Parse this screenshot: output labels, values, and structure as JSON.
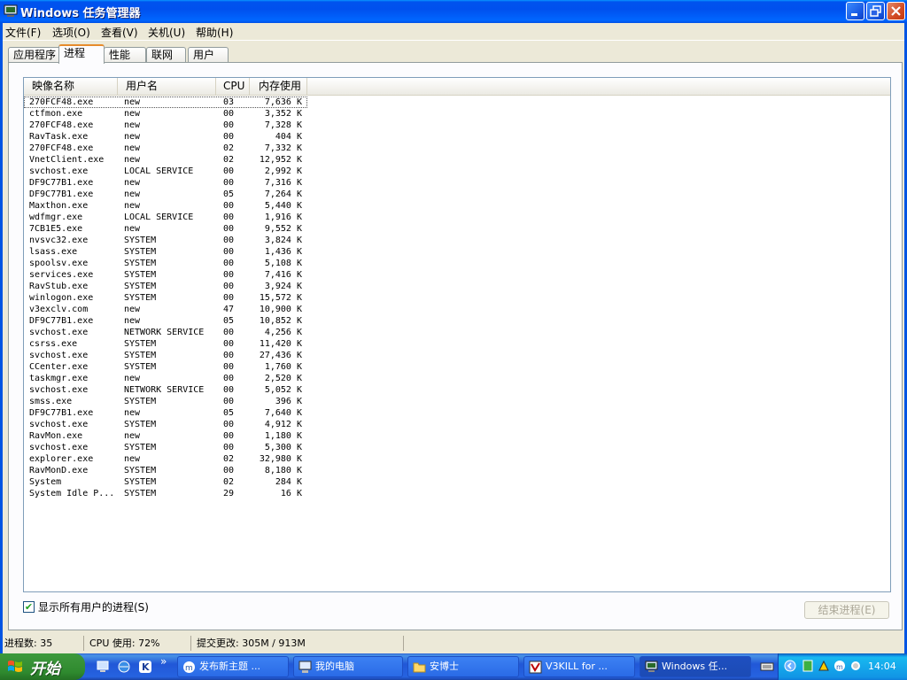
{
  "window": {
    "title": "Windows 任务管理器"
  },
  "menu": [
    "文件(F)",
    "选项(O)",
    "查看(V)",
    "关机(U)",
    "帮助(H)"
  ],
  "tabs": [
    "应用程序",
    "进程",
    "性能",
    "联网",
    "用户"
  ],
  "active_tab": "进程",
  "columns": [
    "映像名称",
    "用户名",
    "CPU",
    "内存使用"
  ],
  "processes": [
    {
      "name": "270FCF48.exe",
      "user": "new",
      "cpu": "03",
      "mem": "7,636 K"
    },
    {
      "name": "ctfmon.exe",
      "user": "new",
      "cpu": "00",
      "mem": "3,352 K"
    },
    {
      "name": "270FCF48.exe",
      "user": "new",
      "cpu": "00",
      "mem": "7,328 K"
    },
    {
      "name": "RavTask.exe",
      "user": "new",
      "cpu": "00",
      "mem": "404 K"
    },
    {
      "name": "270FCF48.exe",
      "user": "new",
      "cpu": "02",
      "mem": "7,332 K"
    },
    {
      "name": "VnetClient.exe",
      "user": "new",
      "cpu": "02",
      "mem": "12,952 K"
    },
    {
      "name": "svchost.exe",
      "user": "LOCAL SERVICE",
      "cpu": "00",
      "mem": "2,992 K"
    },
    {
      "name": "DF9C77B1.exe",
      "user": "new",
      "cpu": "00",
      "mem": "7,316 K"
    },
    {
      "name": "DF9C77B1.exe",
      "user": "new",
      "cpu": "05",
      "mem": "7,264 K"
    },
    {
      "name": "Maxthon.exe",
      "user": "new",
      "cpu": "00",
      "mem": "5,440 K"
    },
    {
      "name": "wdfmgr.exe",
      "user": "LOCAL SERVICE",
      "cpu": "00",
      "mem": "1,916 K"
    },
    {
      "name": "7CB1E5.exe",
      "user": "new",
      "cpu": "00",
      "mem": "9,552 K"
    },
    {
      "name": "nvsvc32.exe",
      "user": "SYSTEM",
      "cpu": "00",
      "mem": "3,824 K"
    },
    {
      "name": "lsass.exe",
      "user": "SYSTEM",
      "cpu": "00",
      "mem": "1,436 K"
    },
    {
      "name": "spoolsv.exe",
      "user": "SYSTEM",
      "cpu": "00",
      "mem": "5,108 K"
    },
    {
      "name": "services.exe",
      "user": "SYSTEM",
      "cpu": "00",
      "mem": "7,416 K"
    },
    {
      "name": "RavStub.exe",
      "user": "SYSTEM",
      "cpu": "00",
      "mem": "3,924 K"
    },
    {
      "name": "winlogon.exe",
      "user": "SYSTEM",
      "cpu": "00",
      "mem": "15,572 K"
    },
    {
      "name": "v3exclv.com",
      "user": "new",
      "cpu": "47",
      "mem": "10,900 K"
    },
    {
      "name": "DF9C77B1.exe",
      "user": "new",
      "cpu": "05",
      "mem": "10,852 K"
    },
    {
      "name": "svchost.exe",
      "user": "NETWORK SERVICE",
      "cpu": "00",
      "mem": "4,256 K"
    },
    {
      "name": "csrss.exe",
      "user": "SYSTEM",
      "cpu": "00",
      "mem": "11,420 K"
    },
    {
      "name": "svchost.exe",
      "user": "SYSTEM",
      "cpu": "00",
      "mem": "27,436 K"
    },
    {
      "name": "CCenter.exe",
      "user": "SYSTEM",
      "cpu": "00",
      "mem": "1,760 K"
    },
    {
      "name": "taskmgr.exe",
      "user": "new",
      "cpu": "00",
      "mem": "2,520 K"
    },
    {
      "name": "svchost.exe",
      "user": "NETWORK SERVICE",
      "cpu": "00",
      "mem": "5,052 K"
    },
    {
      "name": "smss.exe",
      "user": "SYSTEM",
      "cpu": "00",
      "mem": "396 K"
    },
    {
      "name": "DF9C77B1.exe",
      "user": "new",
      "cpu": "05",
      "mem": "7,640 K"
    },
    {
      "name": "svchost.exe",
      "user": "SYSTEM",
      "cpu": "00",
      "mem": "4,912 K"
    },
    {
      "name": "RavMon.exe",
      "user": "new",
      "cpu": "00",
      "mem": "1,180 K"
    },
    {
      "name": "svchost.exe",
      "user": "SYSTEM",
      "cpu": "00",
      "mem": "5,300 K"
    },
    {
      "name": "explorer.exe",
      "user": "new",
      "cpu": "02",
      "mem": "32,980 K"
    },
    {
      "name": "RavMonD.exe",
      "user": "SYSTEM",
      "cpu": "00",
      "mem": "8,180 K"
    },
    {
      "name": "System",
      "user": "SYSTEM",
      "cpu": "02",
      "mem": "284 K"
    },
    {
      "name": "System Idle P...",
      "user": "SYSTEM",
      "cpu": "29",
      "mem": "16 K"
    }
  ],
  "show_all_label": "显示所有用户的进程(S)",
  "show_all_checked": true,
  "end_process_label": "结束进程(E)",
  "status": {
    "processes": "进程数: 35",
    "cpu": "CPU 使用: 72%",
    "commit": "提交更改: 305M / 913M"
  },
  "taskbar": {
    "start_label": "开始",
    "overflow": "»",
    "buttons": [
      {
        "label": "发布新主题 ...",
        "icon": "maxthon-icon"
      },
      {
        "label": "我的电脑",
        "icon": "computer-icon"
      },
      {
        "label": "安博士",
        "icon": "folder-icon"
      },
      {
        "label": "V3KILL for ...",
        "icon": "v3kill-icon"
      },
      {
        "label": "Windows 任...",
        "icon": "taskmgr-icon"
      }
    ],
    "clock": "14:04"
  },
  "colors": {
    "titlebar_blue": "#0054e3",
    "panel_bg": "#ece9d8",
    "start_green": "#389237",
    "active_tab_accent": "#e68b2c"
  }
}
